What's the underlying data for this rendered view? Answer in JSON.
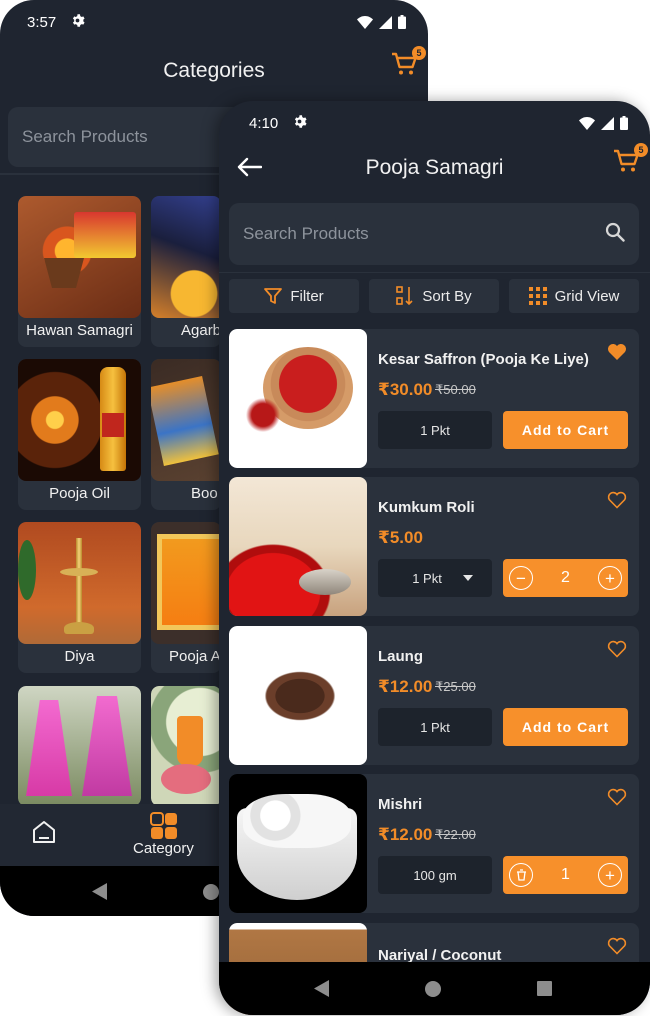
{
  "back_screen": {
    "status": {
      "time": "3:57"
    },
    "title": "Categories",
    "cart_count": "5",
    "search_placeholder": "Search Products",
    "categories": [
      {
        "label": "Hawan Samagri"
      },
      {
        "label": "Agarb"
      },
      {
        "label": "Pooja Oil"
      },
      {
        "label": "Boo"
      },
      {
        "label": "Diya"
      },
      {
        "label": "Pooja A"
      },
      {
        "label": ""
      },
      {
        "label": ""
      }
    ],
    "bottom_nav": {
      "category_label": "Category"
    }
  },
  "front_screen": {
    "status": {
      "time": "4:10"
    },
    "title": "Pooja Samagri",
    "cart_count": "5",
    "search_placeholder": "Search Products",
    "toolbar": {
      "filter": "Filter",
      "sort": "Sort By",
      "grid": "Grid View"
    },
    "products": [
      {
        "name": "Kesar Saffron (Pooja Ke Liye)",
        "price": "₹30.00",
        "mrp": "₹50.00",
        "qty": "1 Pkt",
        "action": "Add to Cart",
        "favorite": true
      },
      {
        "name": "Kumkum Roli",
        "price": "₹5.00",
        "mrp": "",
        "qty": "1 Pkt",
        "count": "2",
        "favorite": false
      },
      {
        "name": "Laung",
        "price": "₹12.00",
        "mrp": "₹25.00",
        "qty": "1 Pkt",
        "action": "Add to Cart",
        "favorite": false
      },
      {
        "name": "Mishri",
        "price": "₹12.00",
        "mrp": "₹22.00",
        "qty": "100 gm",
        "count": "1",
        "favorite": false
      },
      {
        "name": "Nariyal / Coconut",
        "favorite": false
      }
    ]
  },
  "colors": {
    "accent": "#f7902b",
    "background": "#1f2530",
    "surface": "#2a313c"
  }
}
